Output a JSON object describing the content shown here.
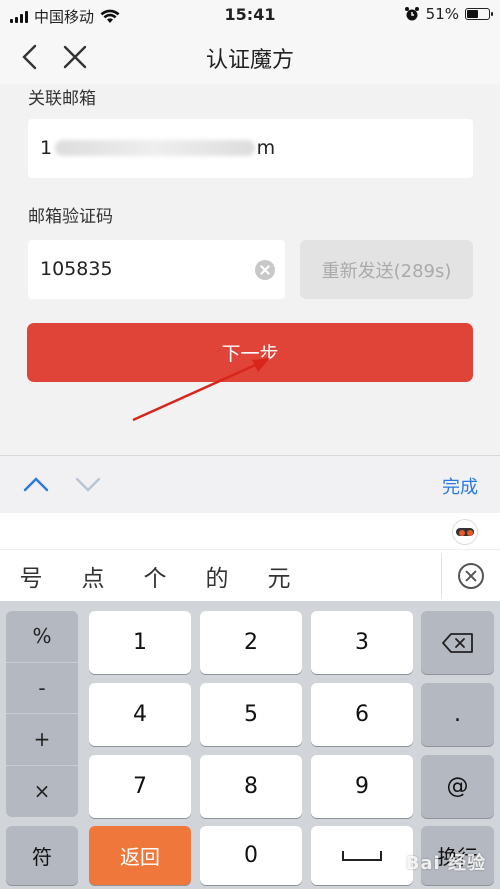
{
  "status_bar": {
    "carrier": "中国移动",
    "time": "15:41",
    "battery": "51%",
    "battery_level": 0.51
  },
  "nav": {
    "title": "认证魔方"
  },
  "form": {
    "email_label": "关联邮箱",
    "email_prefix": "1",
    "email_suffix": "m",
    "code_label": "邮箱验证码",
    "code_value": "105835",
    "resend_label": "重新发送(289s)",
    "next_label": "下一步"
  },
  "accent": {
    "primary_red": "#e04438",
    "link_blue": "#2a7ae2",
    "return_orange": "#f0773b"
  },
  "keyboard": {
    "done_label": "完成",
    "candidates": [
      "号",
      "点",
      "个",
      "的",
      "元"
    ],
    "symbols": [
      "%",
      "-",
      "+",
      "×"
    ],
    "digits": [
      "1",
      "2",
      "3",
      "4",
      "5",
      "6",
      "7",
      "8",
      "9"
    ],
    "zero": "0",
    "dot": ".",
    "at": "@",
    "symbol_key": "符",
    "return_key": "返回",
    "newline_key": "换行"
  },
  "watermark": "Bai 经验"
}
